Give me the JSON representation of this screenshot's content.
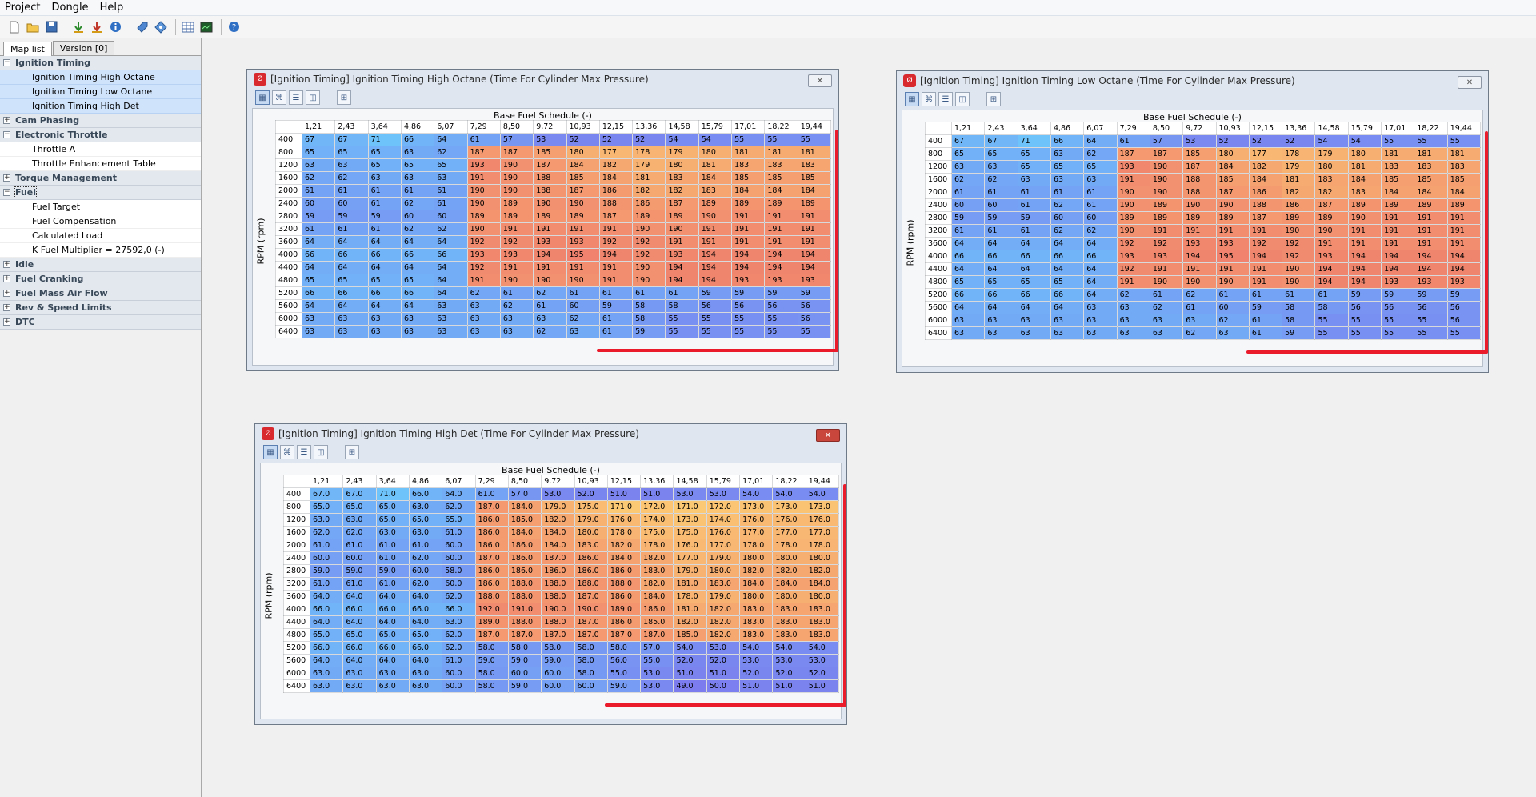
{
  "menu": [
    "Project",
    "Dongle",
    "Help"
  ],
  "toolbar_icons": [
    "new-file-icon",
    "open-folder-icon",
    "save-icon",
    "read-ecu-icon",
    "write-ecu-icon",
    "info-icon",
    "tag-icon",
    "diamond-icon",
    "table-icon",
    "monitor-icon",
    "help-icon"
  ],
  "sidebar": {
    "tabs": [
      "Map list",
      "Version [0]"
    ],
    "tree": [
      {
        "type": "cat",
        "label": "Ignition Timing",
        "expanded": true
      },
      {
        "type": "item",
        "label": "Ignition Timing High Octane",
        "selected": true
      },
      {
        "type": "item",
        "label": "Ignition Timing Low Octane",
        "selected": true
      },
      {
        "type": "item",
        "label": "Ignition Timing High Det",
        "selected": true
      },
      {
        "type": "cat",
        "label": "Cam Phasing",
        "expanded": false
      },
      {
        "type": "cat",
        "label": "Electronic Throttle",
        "expanded": true
      },
      {
        "type": "item",
        "label": "Throttle A",
        "selected": false
      },
      {
        "type": "item",
        "label": "Throttle Enhancement Table",
        "selected": false
      },
      {
        "type": "cat",
        "label": "Torque Management",
        "expanded": false
      },
      {
        "type": "cat",
        "label": "Fuel",
        "expanded": true,
        "focus": true
      },
      {
        "type": "item",
        "label": "Fuel Target",
        "selected": false
      },
      {
        "type": "item",
        "label": "Fuel Compensation",
        "selected": false
      },
      {
        "type": "item",
        "label": "Calculated Load",
        "selected": false
      },
      {
        "type": "item",
        "label": "K Fuel Multiplier = 27592,0 (-)",
        "selected": false
      },
      {
        "type": "cat",
        "label": "Idle",
        "expanded": false
      },
      {
        "type": "cat",
        "label": "Fuel Cranking",
        "expanded": false
      },
      {
        "type": "cat",
        "label": "Fuel Mass Air Flow",
        "expanded": false
      },
      {
        "type": "cat",
        "label": "Rev & Speed Limits",
        "expanded": false
      },
      {
        "type": "cat",
        "label": "DTC",
        "expanded": false
      }
    ]
  },
  "windows": [
    {
      "title": "[Ignition Timing] Ignition Timing High Octane (Time For Cylinder Max Pressure)",
      "x_label": "Base Fuel Schedule (-)",
      "y_label": "RPM (rpm)",
      "decimals": false,
      "close_red": false,
      "cols": [
        "1,21",
        "2,43",
        "3,64",
        "4,86",
        "6,07",
        "7,29",
        "8,50",
        "9,72",
        "10,93",
        "12,15",
        "13,36",
        "14,58",
        "15,79",
        "17,01",
        "18,22",
        "19,44"
      ],
      "rows": [
        "400",
        "800",
        "1200",
        "1600",
        "2000",
        "2400",
        "2800",
        "3200",
        "3600",
        "4000",
        "4400",
        "4800",
        "5200",
        "5600",
        "6000",
        "6400"
      ],
      "values": [
        [
          67,
          67,
          71,
          66,
          64,
          61,
          57,
          53,
          52,
          52,
          52,
          54,
          54,
          55,
          55,
          55
        ],
        [
          65,
          65,
          65,
          63,
          62,
          187,
          187,
          185,
          180,
          177,
          178,
          179,
          180,
          181,
          181,
          181
        ],
        [
          63,
          63,
          65,
          65,
          65,
          193,
          190,
          187,
          184,
          182,
          179,
          180,
          181,
          183,
          183,
          183
        ],
        [
          62,
          62,
          63,
          63,
          63,
          191,
          190,
          188,
          185,
          184,
          181,
          183,
          184,
          185,
          185,
          185
        ],
        [
          61,
          61,
          61,
          61,
          61,
          190,
          190,
          188,
          187,
          186,
          182,
          182,
          183,
          184,
          184,
          184
        ],
        [
          60,
          60,
          61,
          62,
          61,
          190,
          189,
          190,
          190,
          188,
          186,
          187,
          189,
          189,
          189,
          189
        ],
        [
          59,
          59,
          59,
          60,
          60,
          189,
          189,
          189,
          189,
          187,
          189,
          189,
          190,
          191,
          191,
          191
        ],
        [
          61,
          61,
          61,
          62,
          62,
          190,
          191,
          191,
          191,
          191,
          190,
          190,
          191,
          191,
          191,
          191
        ],
        [
          64,
          64,
          64,
          64,
          64,
          192,
          192,
          193,
          193,
          192,
          192,
          191,
          191,
          191,
          191,
          191
        ],
        [
          66,
          66,
          66,
          66,
          66,
          193,
          193,
          194,
          195,
          194,
          192,
          193,
          194,
          194,
          194,
          194
        ],
        [
          64,
          64,
          64,
          64,
          64,
          192,
          191,
          191,
          191,
          191,
          190,
          194,
          194,
          194,
          194,
          194
        ],
        [
          65,
          65,
          65,
          65,
          64,
          191,
          190,
          190,
          190,
          191,
          190,
          194,
          194,
          193,
          193,
          193
        ],
        [
          66,
          66,
          66,
          66,
          64,
          62,
          61,
          62,
          61,
          61,
          61,
          61,
          59,
          59,
          59,
          59
        ],
        [
          64,
          64,
          64,
          64,
          63,
          63,
          62,
          61,
          60,
          59,
          58,
          58,
          56,
          56,
          56,
          56
        ],
        [
          63,
          63,
          63,
          63,
          63,
          63,
          63,
          63,
          62,
          61,
          58,
          55,
          55,
          55,
          55,
          56
        ],
        [
          63,
          63,
          63,
          63,
          63,
          63,
          63,
          62,
          63,
          61,
          59,
          55,
          55,
          55,
          55,
          55
        ]
      ]
    },
    {
      "title": "[Ignition Timing] Ignition Timing Low Octane (Time For Cylinder Max Pressure)",
      "x_label": "Base Fuel Schedule (-)",
      "y_label": "RPM (rpm)",
      "decimals": false,
      "close_red": false,
      "cols": [
        "1,21",
        "2,43",
        "3,64",
        "4,86",
        "6,07",
        "7,29",
        "8,50",
        "9,72",
        "10,93",
        "12,15",
        "13,36",
        "14,58",
        "15,79",
        "17,01",
        "18,22",
        "19,44"
      ],
      "rows": [
        "400",
        "800",
        "1200",
        "1600",
        "2000",
        "2400",
        "2800",
        "3200",
        "3600",
        "4000",
        "4400",
        "4800",
        "5200",
        "5600",
        "6000",
        "6400"
      ],
      "values": [
        [
          67,
          67,
          71,
          66,
          64,
          61,
          57,
          53,
          52,
          52,
          52,
          54,
          54,
          55,
          55,
          55
        ],
        [
          65,
          65,
          65,
          63,
          62,
          187,
          187,
          185,
          180,
          177,
          178,
          179,
          180,
          181,
          181,
          181
        ],
        [
          63,
          63,
          65,
          65,
          65,
          193,
          190,
          187,
          184,
          182,
          179,
          180,
          181,
          183,
          183,
          183
        ],
        [
          62,
          62,
          63,
          63,
          63,
          191,
          190,
          188,
          185,
          184,
          181,
          183,
          184,
          185,
          185,
          185
        ],
        [
          61,
          61,
          61,
          61,
          61,
          190,
          190,
          188,
          187,
          186,
          182,
          182,
          183,
          184,
          184,
          184
        ],
        [
          60,
          60,
          61,
          62,
          61,
          190,
          189,
          190,
          190,
          188,
          186,
          187,
          189,
          189,
          189,
          189
        ],
        [
          59,
          59,
          59,
          60,
          60,
          189,
          189,
          189,
          189,
          187,
          189,
          189,
          190,
          191,
          191,
          191
        ],
        [
          61,
          61,
          61,
          62,
          62,
          190,
          191,
          191,
          191,
          191,
          190,
          190,
          191,
          191,
          191,
          191
        ],
        [
          64,
          64,
          64,
          64,
          64,
          192,
          192,
          193,
          193,
          192,
          192,
          191,
          191,
          191,
          191,
          191
        ],
        [
          66,
          66,
          66,
          66,
          66,
          193,
          193,
          194,
          195,
          194,
          192,
          193,
          194,
          194,
          194,
          194
        ],
        [
          64,
          64,
          64,
          64,
          64,
          192,
          191,
          191,
          191,
          191,
          190,
          194,
          194,
          194,
          194,
          194
        ],
        [
          65,
          65,
          65,
          65,
          64,
          191,
          190,
          190,
          190,
          191,
          190,
          194,
          194,
          193,
          193,
          193
        ],
        [
          66,
          66,
          66,
          66,
          64,
          62,
          61,
          62,
          61,
          61,
          61,
          61,
          59,
          59,
          59,
          59
        ],
        [
          64,
          64,
          64,
          64,
          63,
          63,
          62,
          61,
          60,
          59,
          58,
          58,
          56,
          56,
          56,
          56
        ],
        [
          63,
          63,
          63,
          63,
          63,
          63,
          63,
          63,
          62,
          61,
          58,
          55,
          55,
          55,
          55,
          56
        ],
        [
          63,
          63,
          63,
          63,
          63,
          63,
          63,
          62,
          63,
          61,
          59,
          55,
          55,
          55,
          55,
          55
        ]
      ]
    },
    {
      "title": "[Ignition Timing] Ignition Timing High Det (Time For Cylinder Max Pressure)",
      "x_label": "Base Fuel Schedule (-)",
      "y_label": "RPM (rpm)",
      "decimals": true,
      "close_red": true,
      "cols": [
        "1,21",
        "2,43",
        "3,64",
        "4,86",
        "6,07",
        "7,29",
        "8,50",
        "9,72",
        "10,93",
        "12,15",
        "13,36",
        "14,58",
        "15,79",
        "17,01",
        "18,22",
        "19,44"
      ],
      "rows": [
        "400",
        "800",
        "1200",
        "1600",
        "2000",
        "2400",
        "2800",
        "3200",
        "3600",
        "4000",
        "4400",
        "4800",
        "5200",
        "5600",
        "6000",
        "6400"
      ],
      "values": [
        [
          67,
          67,
          71,
          66,
          64,
          61,
          57,
          53,
          52,
          51,
          51,
          53,
          53,
          54,
          54,
          54
        ],
        [
          65,
          65,
          65,
          63,
          62,
          187,
          184,
          179,
          175,
          171,
          172,
          171,
          172,
          173,
          173,
          173
        ],
        [
          63,
          63,
          65,
          65,
          65,
          186,
          185,
          182,
          179,
          176,
          174,
          173,
          174,
          176,
          176,
          176
        ],
        [
          62,
          62,
          63,
          63,
          61,
          186,
          184,
          184,
          180,
          178,
          175,
          175,
          176,
          177,
          177,
          177
        ],
        [
          61,
          61,
          61,
          61,
          60,
          186,
          186,
          184,
          183,
          182,
          178,
          176,
          177,
          178,
          178,
          178
        ],
        [
          60,
          60,
          61,
          62,
          60,
          187,
          186,
          187,
          186,
          184,
          182,
          177,
          179,
          180,
          180,
          180
        ],
        [
          59,
          59,
          59,
          60,
          58,
          186,
          186,
          186,
          186,
          186,
          183,
          179,
          180,
          182,
          182,
          182
        ],
        [
          61,
          61,
          61,
          62,
          60,
          186,
          188,
          188,
          188,
          188,
          182,
          181,
          183,
          184,
          184,
          184
        ],
        [
          64,
          64,
          64,
          64,
          62,
          188,
          188,
          188,
          187,
          186,
          184,
          178,
          179,
          180,
          180,
          180
        ],
        [
          66,
          66,
          66,
          66,
          66,
          192,
          191,
          190,
          190,
          189,
          186,
          181,
          182,
          183,
          183,
          183
        ],
        [
          64,
          64,
          64,
          64,
          63,
          189,
          188,
          188,
          187,
          186,
          185,
          182,
          182,
          183,
          183,
          183
        ],
        [
          65,
          65,
          65,
          65,
          62,
          187,
          187,
          187,
          187,
          187,
          187,
          185,
          182,
          183,
          183,
          183
        ],
        [
          66,
          66,
          66,
          66,
          62,
          58,
          58,
          58,
          58,
          58,
          57,
          54,
          53,
          54,
          54,
          54
        ],
        [
          64,
          64,
          64,
          64,
          61,
          59,
          59,
          59,
          58,
          56,
          55,
          52,
          52,
          53,
          53,
          53
        ],
        [
          63,
          63,
          63,
          63,
          60,
          58,
          60,
          60,
          58,
          55,
          53,
          51,
          51,
          52,
          52,
          52
        ],
        [
          63,
          63,
          63,
          63,
          60,
          58,
          59,
          60,
          60,
          59,
          53,
          49,
          50,
          51,
          51,
          51
        ]
      ]
    }
  ]
}
